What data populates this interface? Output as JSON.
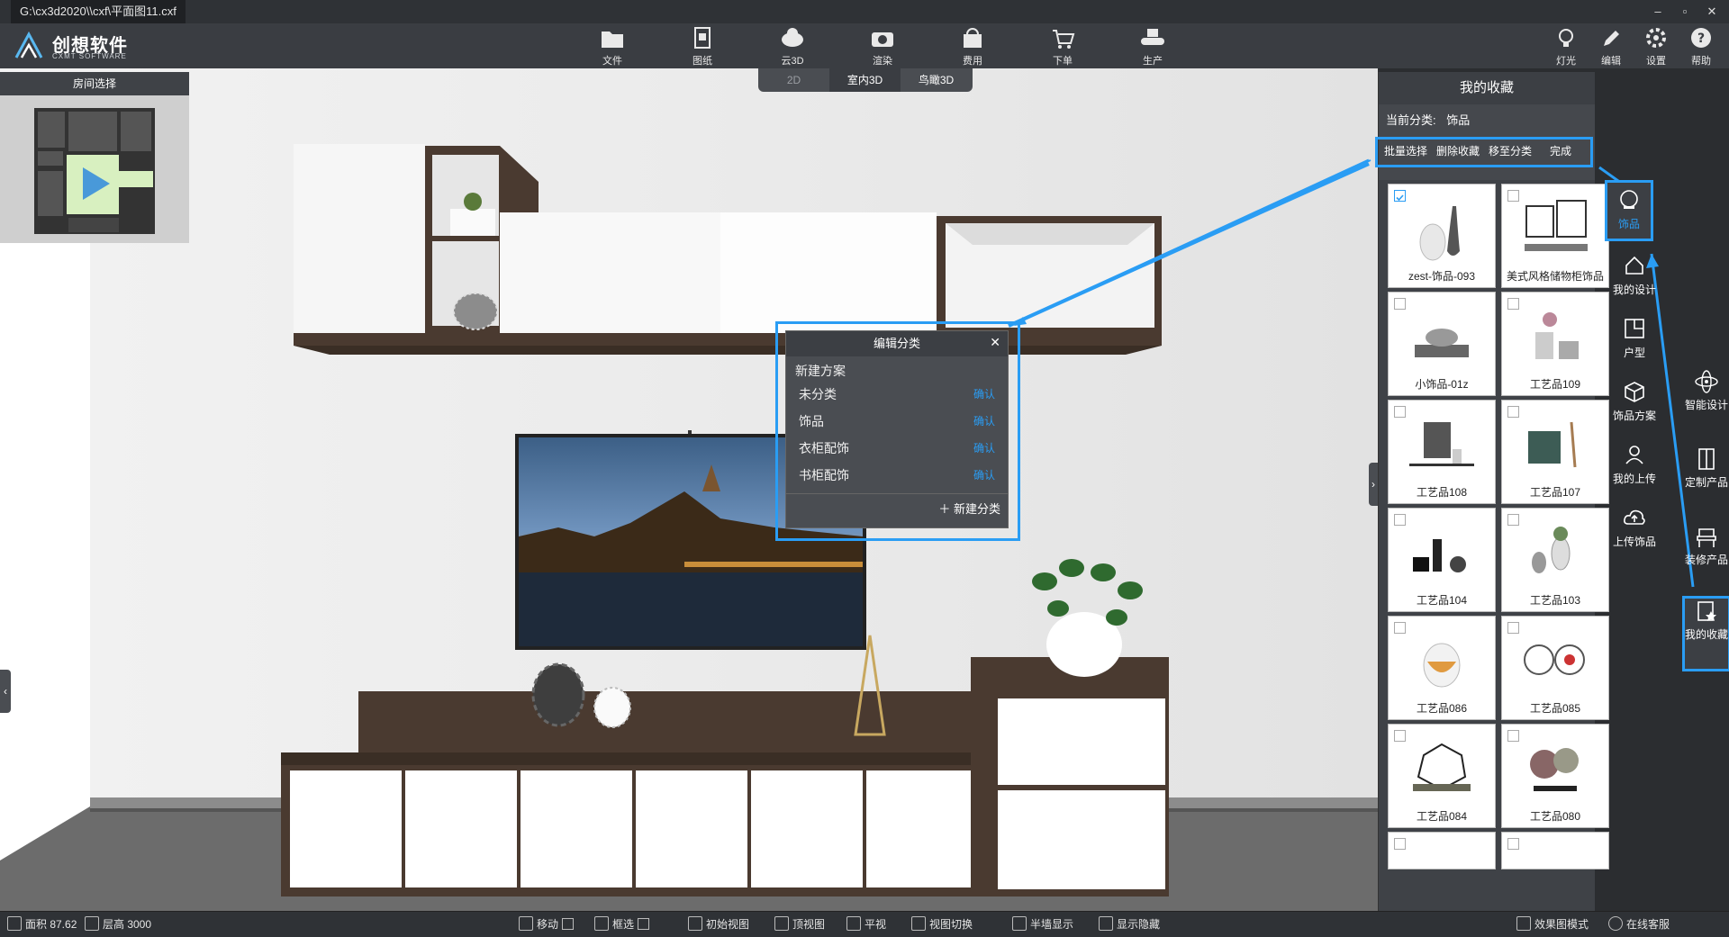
{
  "window": {
    "title": "G:\\cx3d2020\\\\cxf\\平面图11.cxf"
  },
  "logo": {
    "name": "创想软件",
    "sub": "CXMT SOFTWARE"
  },
  "toolbar": {
    "file": "文件",
    "drawing": "图纸",
    "cloud3d": "云3D",
    "render": "渲染",
    "cost": "费用",
    "order": "下单",
    "production": "生产",
    "light": "灯光",
    "edit": "编辑",
    "settings": "设置",
    "help": "帮助"
  },
  "modes": {
    "tab2d": "2D",
    "indoor3d": "室内3D",
    "birdseye3d": "鸟瞰3D",
    "active": "室内3D"
  },
  "room_select": {
    "title": "房间选择"
  },
  "dialog": {
    "title": "编辑分类",
    "new_plan": "新建方案",
    "items": [
      {
        "label": "未分类",
        "confirm": "确认"
      },
      {
        "label": "饰品",
        "confirm": "确认"
      },
      {
        "label": "衣柜配饰",
        "confirm": "确认"
      },
      {
        "label": "书柜配饰",
        "confirm": "确认"
      }
    ],
    "new_category": "新建分类"
  },
  "panel": {
    "title": "我的收藏",
    "current_label": "当前分类:",
    "current_value": "饰品",
    "actions": {
      "batch_select": "批量选择",
      "delete_fav": "删除收藏",
      "move_to": "移至分类",
      "done": "完成"
    },
    "items": [
      {
        "name": "zest-饰品-093",
        "checked": true
      },
      {
        "name": "美式风格储物柜饰品",
        "checked": false
      },
      {
        "name": "小饰品-01z",
        "checked": false
      },
      {
        "name": "工艺品109",
        "checked": false
      },
      {
        "name": "工艺品108",
        "checked": false
      },
      {
        "name": "工艺品107",
        "checked": false
      },
      {
        "name": "工艺品104",
        "checked": false
      },
      {
        "name": "工艺品103",
        "checked": false
      },
      {
        "name": "工艺品086",
        "checked": false
      },
      {
        "name": "工艺品085",
        "checked": false
      },
      {
        "name": "工艺品084",
        "checked": false
      },
      {
        "name": "工艺品080",
        "checked": false
      }
    ]
  },
  "categories": {
    "accessory": "饰品",
    "my_design": "我的设计",
    "floorplan": "户型",
    "accessory_plan": "饰品方案",
    "my_upload": "我的上传",
    "upload_accessory": "上传饰品"
  },
  "rail": {
    "smart_design": "智能设计",
    "custom_product": "定制产品",
    "decor_product": "装修产品",
    "my_fav": "我的收藏"
  },
  "status": {
    "area": "面积 87.62",
    "height": "层高 3000",
    "move": "移动",
    "box_select": "框选",
    "initial_view": "初始视图",
    "top_view": "顶视图",
    "flat_view": "平视",
    "view_switch": "视图切换",
    "half_wall": "半墙显示",
    "show_hide": "显示隐藏",
    "render_mode": "效果图模式",
    "online_service": "在线客服"
  },
  "colors": {
    "accent": "#2a9df4",
    "wood": "#4a3a30"
  }
}
